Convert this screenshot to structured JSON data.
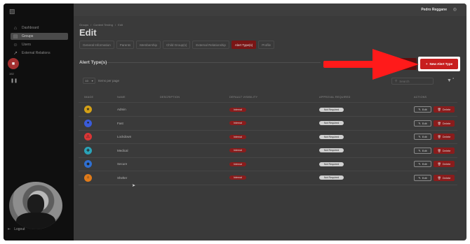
{
  "sidebar": {
    "items": [
      {
        "icon": "home-icon",
        "label": "Dashboard"
      },
      {
        "icon": "groups-icon",
        "label": "Groups"
      },
      {
        "icon": "users-icon",
        "label": "Users"
      },
      {
        "icon": "external-icon",
        "label": "External Relations"
      }
    ],
    "rail_count": "192",
    "logout_label": "Logout"
  },
  "header": {
    "user_name": "Pedro Reggane"
  },
  "breadcrumb": [
    "Groups",
    "/",
    "Content Testing",
    "/",
    "Edit"
  ],
  "page_title": "Edit",
  "tabs": [
    "General Information",
    "Parents",
    "Membership",
    "Child Group(s)",
    "External Relationship",
    "Alert Type(s)",
    "Profile"
  ],
  "active_tab": "Alert Type(s)",
  "section_title": "Alert Type(s)",
  "toolbar": {
    "new_button_label": "New Alert Type",
    "per_page_value": "10",
    "per_page_label": "Items per page",
    "search_placeholder": "Search"
  },
  "table": {
    "columns": [
      "IMAGE",
      "NAME",
      "DESCRIPTION",
      "DEFAULT VISIBILITY",
      "APPROVAL REQUIRED",
      "ACTIONS"
    ],
    "rows": [
      {
        "name": "Admin",
        "visibility": "Internal",
        "approval": "Not Required",
        "avatar_color": "#d4a017"
      },
      {
        "name": "Fast",
        "visibility": "Internal",
        "approval": "Not Required",
        "avatar_color": "#3a5bd9"
      },
      {
        "name": "Lockdown",
        "visibility": "Internal",
        "approval": "Not Required",
        "avatar_color": "#d93636"
      },
      {
        "name": "Medical",
        "visibility": "Internal",
        "approval": "Not Required",
        "avatar_color": "#2aa3b8"
      },
      {
        "name": "Secure",
        "visibility": "Internal",
        "approval": "Not Required",
        "avatar_color": "#2f6fd1"
      },
      {
        "name": "Shelter",
        "visibility": "Internal",
        "approval": "Not Required",
        "avatar_color": "#e07b1a"
      }
    ],
    "edit_label": "Edit",
    "delete_label": "Delete"
  },
  "colors": {
    "accent": "#c81e1e",
    "arrow": "#ff0000"
  }
}
